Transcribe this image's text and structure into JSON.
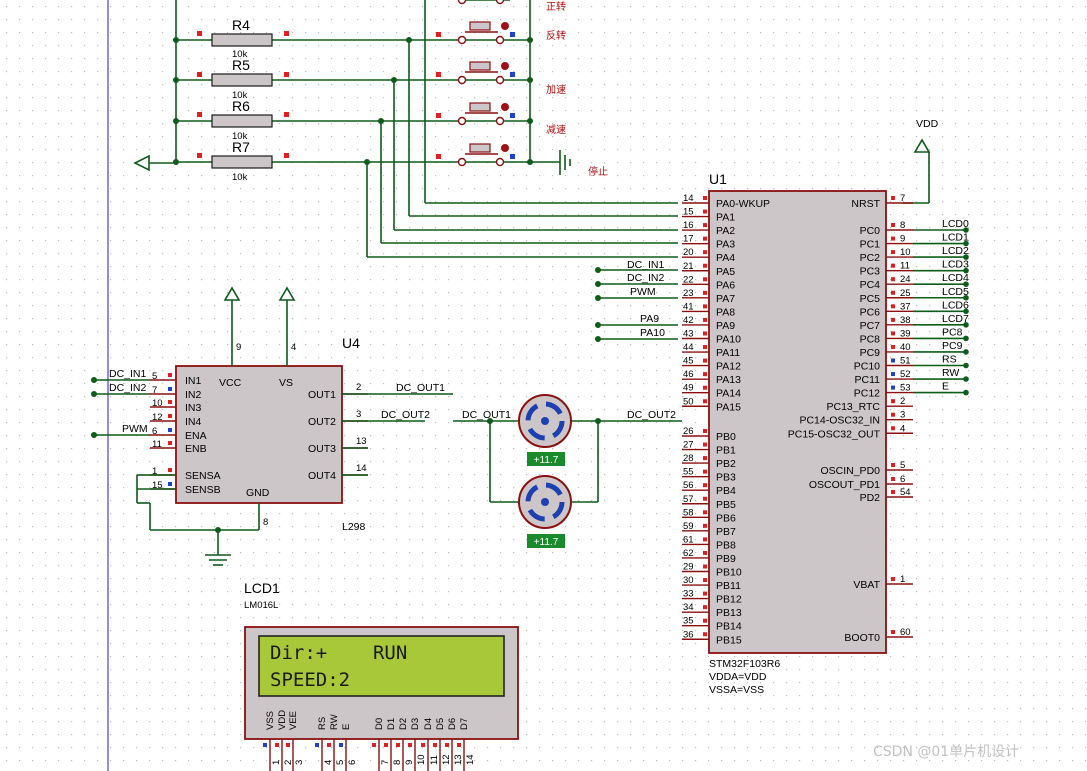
{
  "colors": {
    "wire": "#0d5c18",
    "component_body": "#ccc6c8",
    "component_border": "#8a1010",
    "lcd_screen": "#a8c83a",
    "grid_dot": "#bfbfbf",
    "label_red": "#b01010"
  },
  "resistors": [
    {
      "name": "R4",
      "value": "10k"
    },
    {
      "name": "R5",
      "value": "10k"
    },
    {
      "name": "R6",
      "value": "10k"
    },
    {
      "name": "R7",
      "value": "10k"
    }
  ],
  "buttons": [
    "正转",
    "反转",
    "加速",
    "减速",
    "停止"
  ],
  "vdd_label": "VDD",
  "mcu": {
    "ref": "U1",
    "part": "STM32F103R6",
    "power": [
      "VDDA=VDD",
      "VSSA=VSS"
    ],
    "left_pins": [
      {
        "num": "14",
        "name": "PA0-WKUP"
      },
      {
        "num": "15",
        "name": "PA1"
      },
      {
        "num": "16",
        "name": "PA2"
      },
      {
        "num": "17",
        "name": "PA3"
      },
      {
        "num": "20",
        "name": "PA4"
      },
      {
        "num": "21",
        "name": "PA5"
      },
      {
        "num": "22",
        "name": "PA6"
      },
      {
        "num": "23",
        "name": "PA7"
      },
      {
        "num": "41",
        "name": "PA8"
      },
      {
        "num": "42",
        "name": "PA9"
      },
      {
        "num": "43",
        "name": "PA10"
      },
      {
        "num": "44",
        "name": "PA11"
      },
      {
        "num": "45",
        "name": "PA12"
      },
      {
        "num": "46",
        "name": "PA13"
      },
      {
        "num": "49",
        "name": "PA14"
      },
      {
        "num": "50",
        "name": "PA15"
      },
      {
        "num": "26",
        "name": "PB0"
      },
      {
        "num": "27",
        "name": "PB1"
      },
      {
        "num": "28",
        "name": "PB2"
      },
      {
        "num": "55",
        "name": "PB3"
      },
      {
        "num": "56",
        "name": "PB4"
      },
      {
        "num": "57",
        "name": "PB5"
      },
      {
        "num": "58",
        "name": "PB6"
      },
      {
        "num": "59",
        "name": "PB7"
      },
      {
        "num": "61",
        "name": "PB8"
      },
      {
        "num": "62",
        "name": "PB9"
      },
      {
        "num": "29",
        "name": "PB10"
      },
      {
        "num": "30",
        "name": "PB11"
      },
      {
        "num": "33",
        "name": "PB12"
      },
      {
        "num": "34",
        "name": "PB13"
      },
      {
        "num": "35",
        "name": "PB14"
      },
      {
        "num": "36",
        "name": "PB15"
      }
    ],
    "right_pins": [
      {
        "num": "7",
        "name": "NRST",
        "net": ""
      },
      {
        "num": "8",
        "name": "PC0",
        "net": "LCD0"
      },
      {
        "num": "9",
        "name": "PC1",
        "net": "LCD1"
      },
      {
        "num": "10",
        "name": "PC2",
        "net": "LCD2"
      },
      {
        "num": "11",
        "name": "PC3",
        "net": "LCD3"
      },
      {
        "num": "24",
        "name": "PC4",
        "net": "LCD4"
      },
      {
        "num": "25",
        "name": "PC5",
        "net": "LCD5"
      },
      {
        "num": "37",
        "name": "PC6",
        "net": "LCD6"
      },
      {
        "num": "38",
        "name": "PC7",
        "net": "LCD7"
      },
      {
        "num": "39",
        "name": "PC8",
        "net": "PC8"
      },
      {
        "num": "40",
        "name": "PC9",
        "net": "PC9"
      },
      {
        "num": "51",
        "name": "PC10",
        "net": "RS"
      },
      {
        "num": "52",
        "name": "PC11",
        "net": "RW"
      },
      {
        "num": "53",
        "name": "PC12",
        "net": "E"
      },
      {
        "num": "2",
        "name": "PC13_RTC",
        "net": ""
      },
      {
        "num": "3",
        "name": "PC14-OSC32_IN",
        "net": ""
      },
      {
        "num": "4",
        "name": "PC15-OSC32_OUT",
        "net": ""
      },
      {
        "num": "5",
        "name": "OSCIN_PD0",
        "net": ""
      },
      {
        "num": "6",
        "name": "OSCOUT_PD1",
        "net": ""
      },
      {
        "num": "54",
        "name": "PD2",
        "net": ""
      },
      {
        "num": "1",
        "name": "VBAT",
        "net": ""
      },
      {
        "num": "60",
        "name": "BOOT0",
        "net": ""
      }
    ],
    "nets_left": [
      "DC_IN1",
      "DC_IN2",
      "PWM",
      "PA9",
      "PA10"
    ]
  },
  "driver": {
    "ref": "U4",
    "part": "L298",
    "left_pins": [
      {
        "num": "5",
        "name": "IN1",
        "net": "DC_IN1"
      },
      {
        "num": "7",
        "name": "IN2",
        "net": "DC_IN2"
      },
      {
        "num": "10",
        "name": "IN3",
        "net": ""
      },
      {
        "num": "12",
        "name": "IN4",
        "net": ""
      },
      {
        "num": "6",
        "name": "ENA",
        "net": "PWM"
      },
      {
        "num": "11",
        "name": "ENB",
        "net": ""
      },
      {
        "num": "1",
        "name": "SENSA",
        "net": ""
      },
      {
        "num": "15",
        "name": "SENSB",
        "net": ""
      }
    ],
    "top_pins": [
      {
        "num": "9",
        "name": "VCC"
      },
      {
        "num": "4",
        "name": "VS"
      }
    ],
    "bottom_pin": {
      "num": "8",
      "name": "GND"
    },
    "right_pins": [
      {
        "num": "2",
        "name": "OUT1",
        "net": "DC_OUT1"
      },
      {
        "num": "3",
        "name": "OUT2",
        "net": "DC_OUT2"
      },
      {
        "num": "13",
        "name": "OUT3",
        "net": ""
      },
      {
        "num": "14",
        "name": "OUT4",
        "net": ""
      }
    ]
  },
  "motor_nets": [
    "DC_OUT1",
    "DC_OUT2"
  ],
  "motors": [
    {
      "value": "+11.7"
    },
    {
      "value": "+11.7"
    }
  ],
  "lcd": {
    "ref": "LCD1",
    "part": "LM016L",
    "line1": "Dir:+    RUN",
    "line2": "SPEED:2",
    "pins": [
      {
        "name": "VSS",
        "num": "1"
      },
      {
        "name": "VDD",
        "num": "2"
      },
      {
        "name": "VEE",
        "num": "3"
      },
      {
        "name": "RS",
        "num": "4"
      },
      {
        "name": "RW",
        "num": "5"
      },
      {
        "name": "E",
        "num": "6"
      },
      {
        "name": "D0",
        "num": "7"
      },
      {
        "name": "D1",
        "num": "8"
      },
      {
        "name": "D2",
        "num": "9"
      },
      {
        "name": "D3",
        "num": "10"
      },
      {
        "name": "D4",
        "num": "11"
      },
      {
        "name": "D5",
        "num": "12"
      },
      {
        "name": "D6",
        "num": "13"
      },
      {
        "name": "D7",
        "num": "14"
      }
    ]
  },
  "watermark": "CSDN @01单片机设计"
}
